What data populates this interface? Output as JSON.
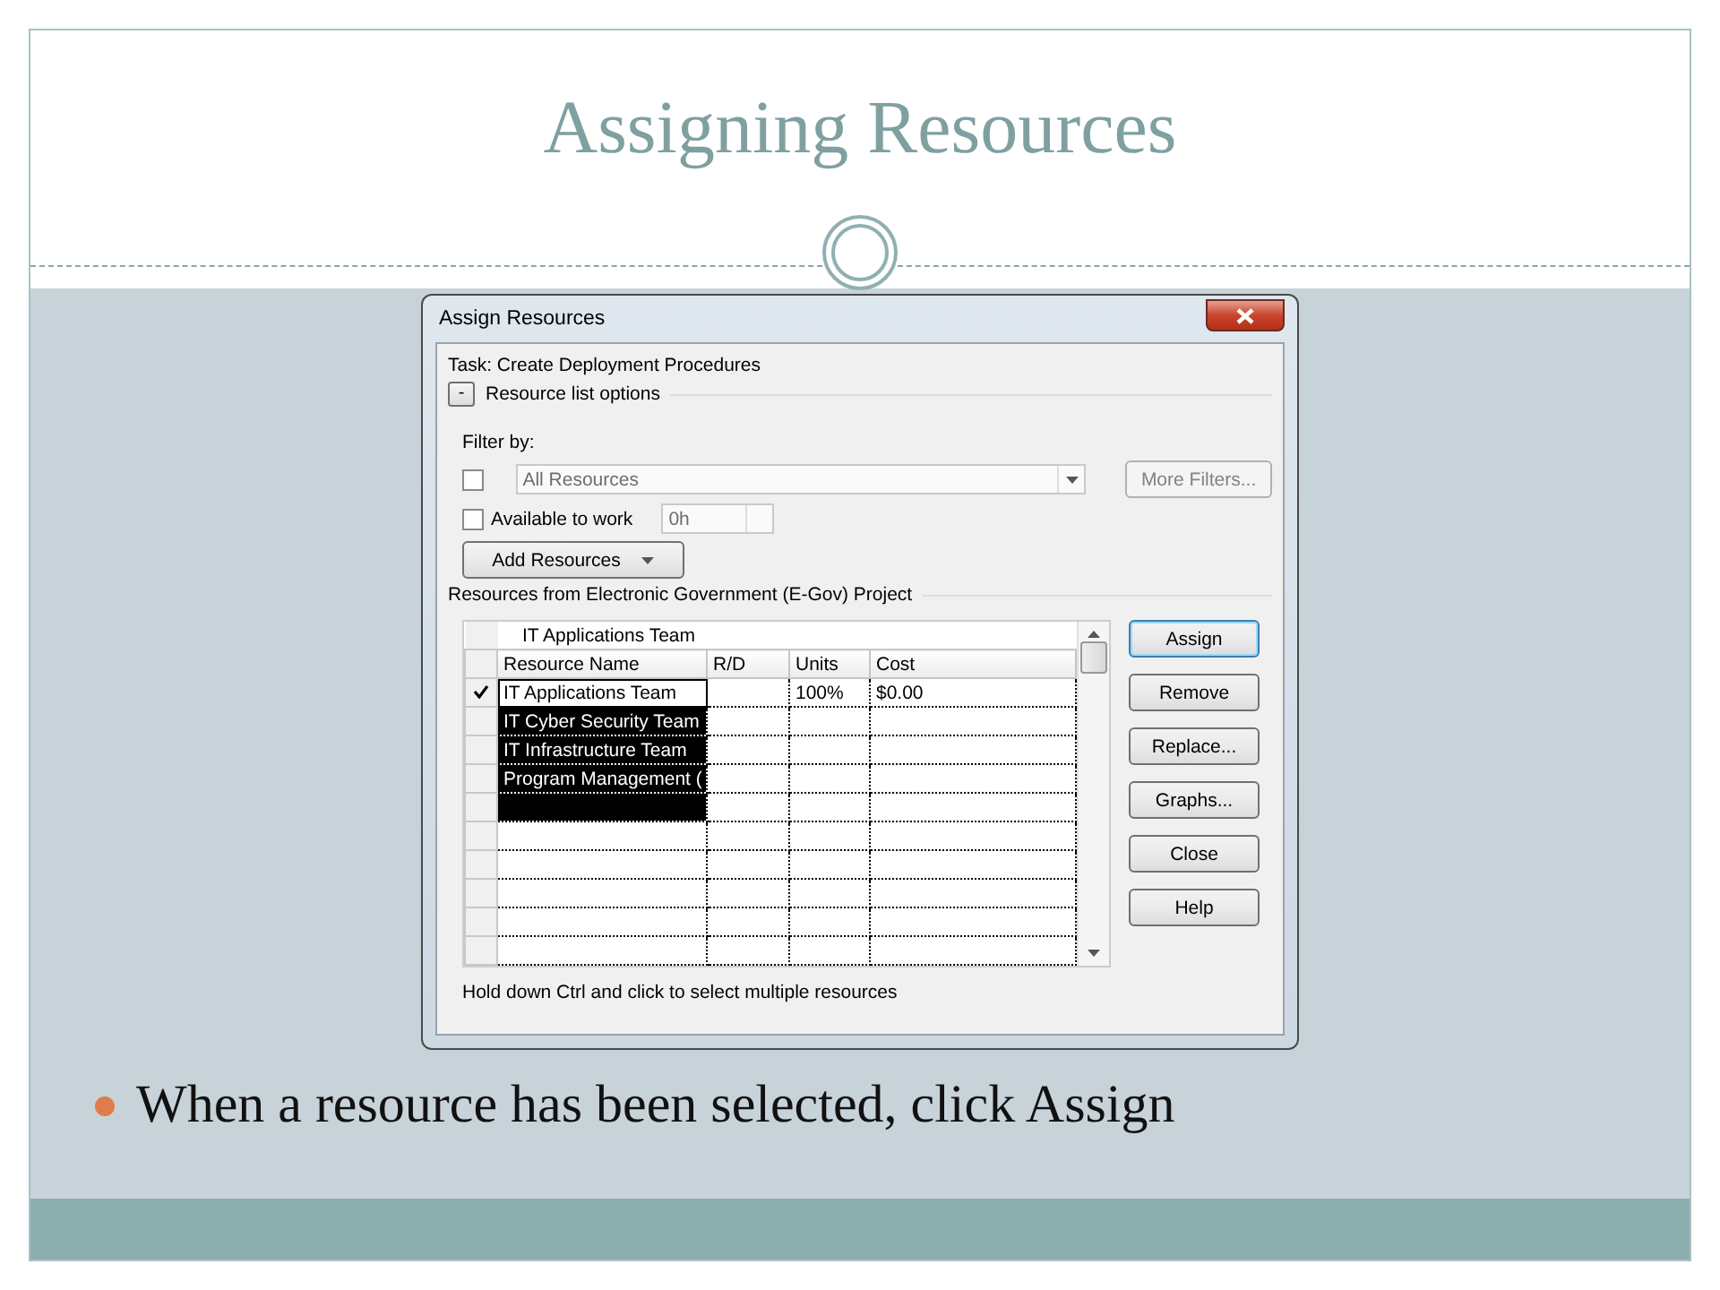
{
  "slide": {
    "title": "Assigning Resources",
    "bullets": [
      "When a resource has been selected, click Assign"
    ]
  },
  "dialog": {
    "title": "Assign Resources",
    "task": "Task: Create Deployment Procedures",
    "options_toggle": "-",
    "options_label": "Resource list options",
    "filter_label": "Filter by:",
    "filter": {
      "checked": false,
      "value": "All Resources",
      "disabled": true
    },
    "more_filters": {
      "label": "More Filters...",
      "disabled": true
    },
    "available": {
      "label": "Available to work",
      "checked": false,
      "value": "0h",
      "disabled": true
    },
    "add_resources": "Add Resources",
    "resources_label": "Resources from Electronic Government (E-Gov) Project",
    "edit_value": "IT Applications Team",
    "columns": [
      "Resource Name",
      "R/D",
      "Units",
      "Cost"
    ],
    "rows": [
      {
        "assigned": true,
        "name": "IT Applications Team",
        "units": "100%",
        "cost": "$0.00",
        "selected": false,
        "focused": true
      },
      {
        "assigned": false,
        "name": "IT Cyber Security Team",
        "selected": true,
        "focused": false
      },
      {
        "assigned": false,
        "name": "IT Infrastructure Team",
        "selected": true,
        "focused": false
      },
      {
        "assigned": false,
        "name": "Program Management (",
        "selected": true,
        "focused": false
      },
      {
        "assigned": false,
        "selected": true,
        "focused": false
      },
      {
        "assigned": false,
        "selected": false,
        "focused": false
      },
      {
        "assigned": false,
        "selected": false,
        "focused": false
      },
      {
        "assigned": false,
        "selected": false,
        "focused": false
      },
      {
        "assigned": false,
        "selected": false,
        "focused": false
      },
      {
        "assigned": false,
        "selected": false,
        "focused": false
      }
    ],
    "buttons": [
      {
        "label": "Assign",
        "default": true
      },
      {
        "label": "Remove",
        "default": false
      },
      {
        "label": "Replace...",
        "default": false
      },
      {
        "label": "Graphs...",
        "default": false
      },
      {
        "label": "Close",
        "default": false
      },
      {
        "label": "Help",
        "default": false
      }
    ],
    "hint": "Hold down Ctrl and click to select multiple resources"
  }
}
